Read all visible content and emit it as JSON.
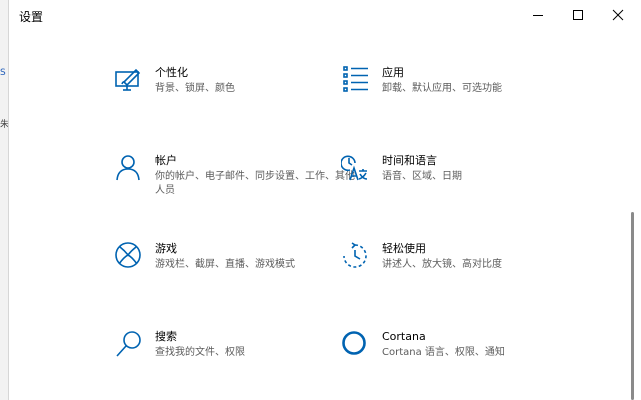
{
  "window": {
    "title": "设置",
    "accent": "#0063b1"
  },
  "background_window": {
    "fragment_1": "S",
    "fragment_2": "朱"
  },
  "categories": [
    {
      "title": "个性化",
      "desc": "背景、锁屏、颜色",
      "icon": "personalization-icon"
    },
    {
      "title": "应用",
      "desc": "卸载、默认应用、可选功能",
      "icon": "apps-icon"
    },
    {
      "title": "帐户",
      "desc": "你的帐户、电子邮件、同步设置、工作、其他人员",
      "icon": "accounts-icon"
    },
    {
      "title": "时间和语言",
      "desc": "语音、区域、日期",
      "icon": "time-language-icon"
    },
    {
      "title": "游戏",
      "desc": "游戏栏、截屏、直播、游戏模式",
      "icon": "gaming-icon"
    },
    {
      "title": "轻松使用",
      "desc": "讲述人、放大镜、高对比度",
      "icon": "ease-of-access-icon"
    },
    {
      "title": "搜索",
      "desc": "查找我的文件、权限",
      "icon": "search-icon"
    },
    {
      "title": "Cortana",
      "desc": "Cortana 语言、权限、通知",
      "icon": "cortana-icon"
    }
  ]
}
